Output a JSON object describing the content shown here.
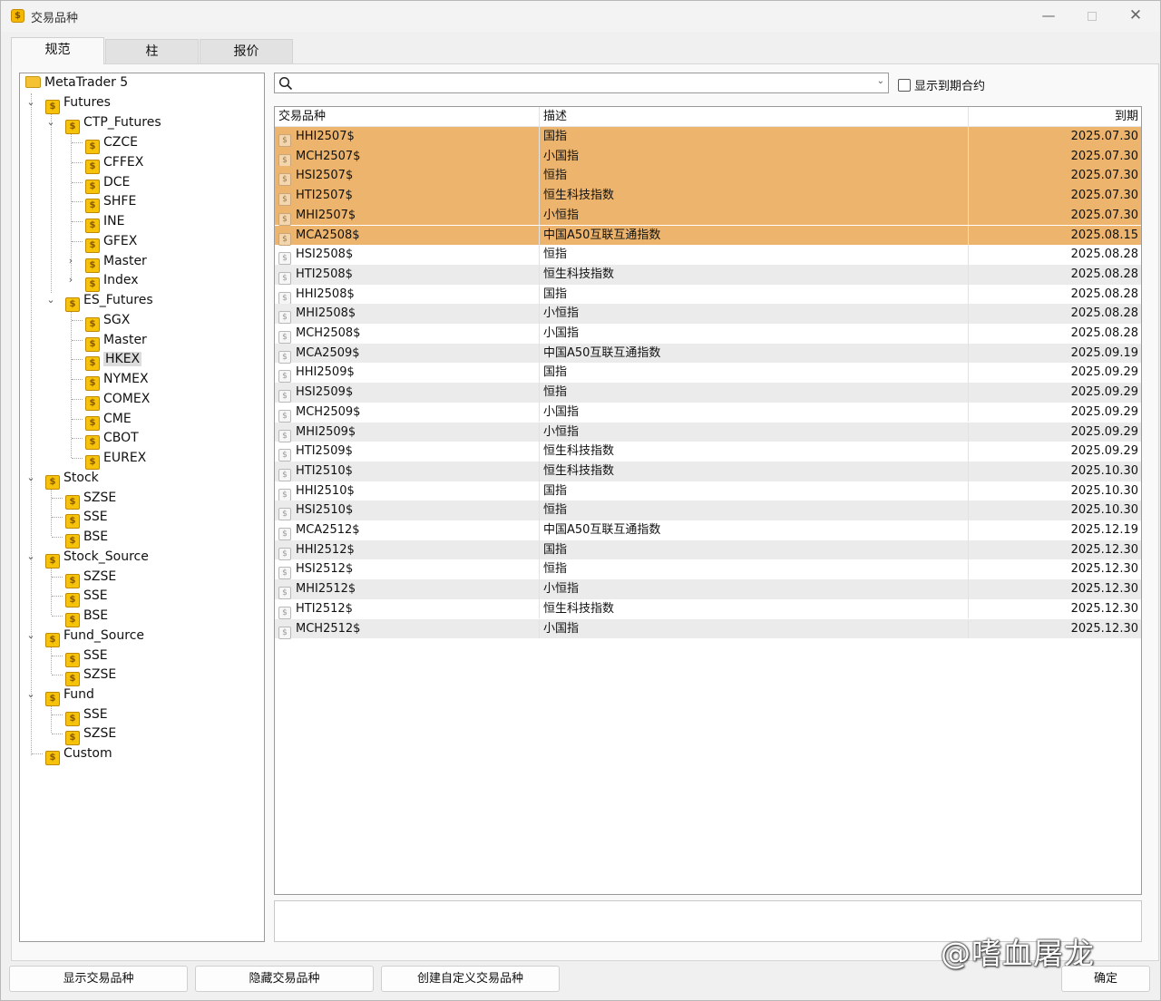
{
  "window": {
    "title": "交易品种"
  },
  "tabs": [
    {
      "label": "规范"
    },
    {
      "label": "柱"
    },
    {
      "label": "报价"
    }
  ],
  "tree": {
    "root": "MetaTrader 5",
    "nodes": [
      {
        "label": "Futures"
      },
      {
        "label": "CTP_Futures"
      },
      {
        "label": "CZCE"
      },
      {
        "label": "CFFEX"
      },
      {
        "label": "DCE"
      },
      {
        "label": "SHFE"
      },
      {
        "label": "INE"
      },
      {
        "label": "GFEX"
      },
      {
        "label": "Master"
      },
      {
        "label": "Index"
      },
      {
        "label": "ES_Futures"
      },
      {
        "label": "SGX"
      },
      {
        "label": "Master"
      },
      {
        "label": "HKEX"
      },
      {
        "label": "NYMEX"
      },
      {
        "label": "COMEX"
      },
      {
        "label": "CME"
      },
      {
        "label": "CBOT"
      },
      {
        "label": "EUREX"
      },
      {
        "label": "Stock"
      },
      {
        "label": "SZSE"
      },
      {
        "label": "SSE"
      },
      {
        "label": "BSE"
      },
      {
        "label": "Stock_Source"
      },
      {
        "label": "SZSE"
      },
      {
        "label": "SSE"
      },
      {
        "label": "BSE"
      },
      {
        "label": "Fund_Source"
      },
      {
        "label": "SSE"
      },
      {
        "label": "SZSE"
      },
      {
        "label": "Fund"
      },
      {
        "label": "SSE"
      },
      {
        "label": "SZSE"
      },
      {
        "label": "Custom"
      }
    ]
  },
  "search": {
    "value": "",
    "placeholder": ""
  },
  "show_expired_label": "显示到期合约",
  "table": {
    "headers": [
      "交易品种",
      "描述",
      "到期"
    ],
    "rows": [
      [
        "HHI2507$",
        "国指",
        "2025.07.30"
      ],
      [
        "MCH2507$",
        "小国指",
        "2025.07.30"
      ],
      [
        "HSI2507$",
        "恒指",
        "2025.07.30"
      ],
      [
        "HTI2507$",
        "恒生科技指数",
        "2025.07.30"
      ],
      [
        "MHI2507$",
        "小恒指",
        "2025.07.30"
      ],
      [
        "MCA2508$",
        "中国A50互联互通指数",
        "2025.08.15"
      ],
      [
        "HSI2508$",
        "恒指",
        "2025.08.28"
      ],
      [
        "HTI2508$",
        "恒生科技指数",
        "2025.08.28"
      ],
      [
        "HHI2508$",
        "国指",
        "2025.08.28"
      ],
      [
        "MHI2508$",
        "小恒指",
        "2025.08.28"
      ],
      [
        "MCH2508$",
        "小国指",
        "2025.08.28"
      ],
      [
        "MCA2509$",
        "中国A50互联互通指数",
        "2025.09.19"
      ],
      [
        "HHI2509$",
        "国指",
        "2025.09.29"
      ],
      [
        "HSI2509$",
        "恒指",
        "2025.09.29"
      ],
      [
        "MCH2509$",
        "小国指",
        "2025.09.29"
      ],
      [
        "MHI2509$",
        "小恒指",
        "2025.09.29"
      ],
      [
        "HTI2509$",
        "恒生科技指数",
        "2025.09.29"
      ],
      [
        "HTI2510$",
        "恒生科技指数",
        "2025.10.30"
      ],
      [
        "HHI2510$",
        "国指",
        "2025.10.30"
      ],
      [
        "HSI2510$",
        "恒指",
        "2025.10.30"
      ],
      [
        "MCA2512$",
        "中国A50互联互通指数",
        "2025.12.19"
      ],
      [
        "HHI2512$",
        "国指",
        "2025.12.30"
      ],
      [
        "HSI2512$",
        "恒指",
        "2025.12.30"
      ],
      [
        "MHI2512$",
        "小恒指",
        "2025.12.30"
      ],
      [
        "HTI2512$",
        "恒生科技指数",
        "2025.12.30"
      ],
      [
        "MCH2512$",
        "小国指",
        "2025.12.30"
      ]
    ],
    "highlighted_count": 6,
    "highlight_color": "#ecb46c"
  },
  "watermark": "@嗜血屠龙",
  "buttons": {
    "show": "显示交易品种",
    "hide": "隐藏交易品种",
    "create": "创建自定义交易品种",
    "ok": "确定"
  }
}
